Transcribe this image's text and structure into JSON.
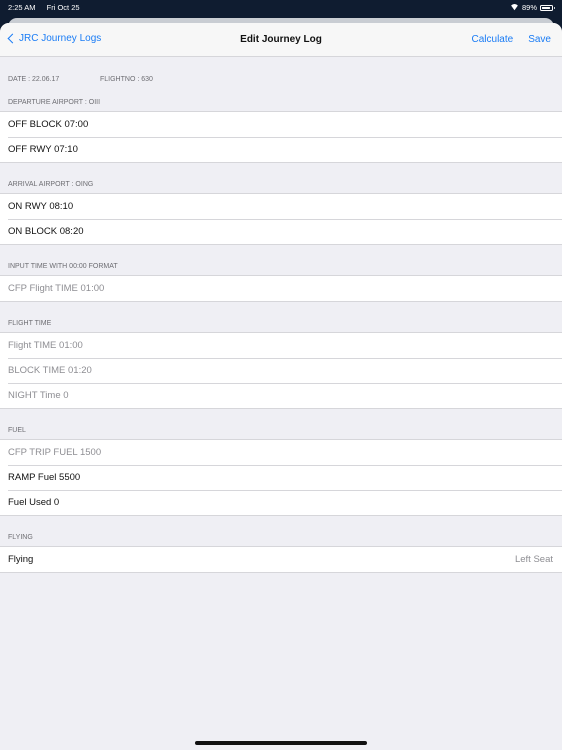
{
  "status_bar": {
    "time": "2:25 AM",
    "date": "Fri Oct 25",
    "battery": "89%",
    "battery_level": 0.89
  },
  "nav": {
    "back_label": "JRC Journey Logs",
    "title": "Edit Journey Log",
    "calculate_label": "Calculate",
    "save_label": "Save"
  },
  "info": {
    "date": "DATE : 22.06.17",
    "flight": "FLIGHTNO : 630"
  },
  "sections": {
    "departure": {
      "header": "DEPARTURE  AIRPORT : OIII",
      "rows": [
        "OFF BLOCK  07:00",
        "OFF RWY  07:10"
      ]
    },
    "arrival": {
      "header": "ARRIVAL AIRPORT : OING",
      "rows": [
        "ON RWY  08:10",
        "ON BLOCK  08:20"
      ]
    },
    "input_time": {
      "header": "INPUT TIME WITH 00:00 FORMAT",
      "rows": [
        "CFP Flight TIME  01:00"
      ]
    },
    "flight_time": {
      "header": "FLIGHT TIME",
      "rows": [
        "Flight TIME  01:00",
        "BLOCK TIME  01:20",
        "NIGHT Time  0"
      ]
    },
    "fuel": {
      "header": "FUEL",
      "rows": [
        "CFP TRIP FUEL  1500",
        "RAMP Fuel  5500",
        "Fuel Used  0"
      ]
    },
    "flying": {
      "header": "FLYING",
      "label": "Flying",
      "value": "Left Seat"
    }
  }
}
